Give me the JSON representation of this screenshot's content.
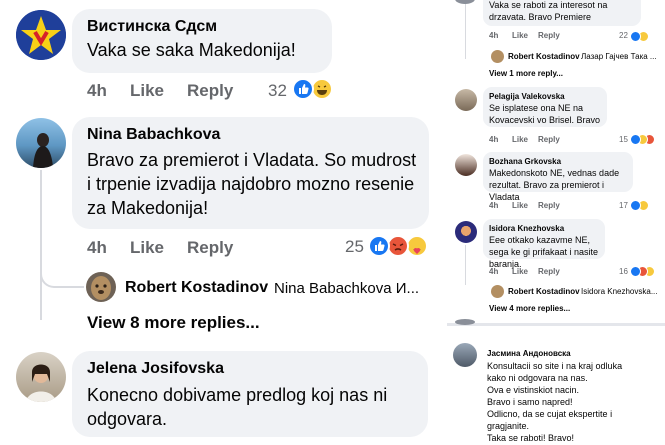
{
  "comments": [
    {
      "author": "Вистинска Сдсм",
      "text": "Vaka se saka Makedonija!",
      "time": "4h",
      "like": "Like",
      "reply": "Reply",
      "reaction_count": "32"
    },
    {
      "author": "Nina Babachkova",
      "text": "Bravo za premierot i Vladata. So mudrost i trpenie izvadija najdobro mozno resenie za Makedonija!",
      "time": "4h",
      "like": "Like",
      "reply": "Reply",
      "reaction_count": "25",
      "reply_preview": {
        "author": "Robert Kostadinov",
        "text": "Nina Babachkova И..."
      },
      "view_more": "View 8 more replies..."
    },
    {
      "author": "Jelena Josifovska",
      "text": "Konecno dobivame predlog koj nas ni odgovara."
    }
  ],
  "right_comments": [
    {
      "text": "Vaka se raboti za interesot na drzavata. Bravo Premiere",
      "time": "4h",
      "like": "Like",
      "reply": "Reply",
      "reaction_count": "22",
      "reply_preview": {
        "author": "Robert Kostadinov",
        "text": "Лазар Гајчев Така ..."
      },
      "view_more": "View 1 more reply..."
    },
    {
      "author": "Pelagija Valekovska",
      "text": "Se isplatese ona NE na Kovacevski vo Brisel. Bravo",
      "time": "4h",
      "like": "Like",
      "reply": "Reply",
      "reaction_count": "15"
    },
    {
      "author": "Bozhana Grkovska",
      "text": "Makedonskoto NE, vednas dade rezultat. Bravo za premierot i Vladata",
      "time": "4h",
      "like": "Like",
      "reply": "Reply",
      "reaction_count": "17"
    },
    {
      "author": "Isidora Knezhovska",
      "text": "Eee otkako kazavme NE, sega ke gi prifakaat i nasite baranja.",
      "time": "4h",
      "like": "Like",
      "reply": "Reply",
      "reaction_count": "16",
      "reply_preview": {
        "author": "Robert Kostadinov",
        "text": "Isidora Knezhovska..."
      },
      "view_more": "View 4 more replies..."
    },
    {
      "author": "Јасмина Андоновска",
      "text_lines": [
        "Konsultacii so site i na kraj odluka",
        "kako ni odgovara na nas.",
        "Ova e vistinskiot nacin.",
        "Bravo i samo napred!",
        "Odlicno, da se cujat ekspertite i",
        "gragjanite.",
        "Taka se raboti! Bravo!"
      ]
    }
  ]
}
